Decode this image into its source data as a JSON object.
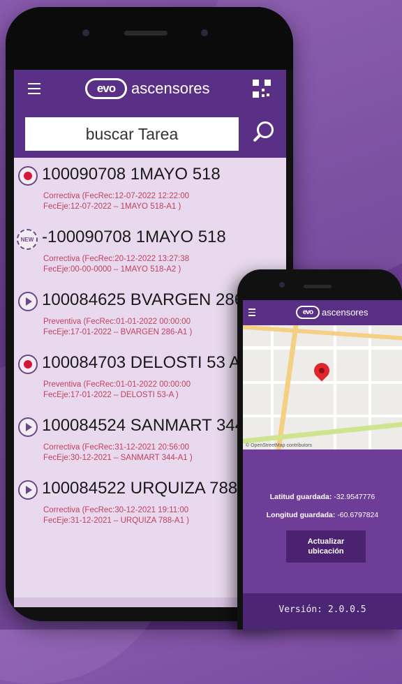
{
  "main_app": {
    "logo_mark": "evo",
    "brand": "ascensores",
    "search_placeholder": "buscar Tarea",
    "tasks": [
      {
        "status": "red-dot",
        "title": "100090708 1MAYO  518",
        "line1": "Correctiva (FecRec:12-07-2022 12:22:00",
        "line2": "FecEje:12-07-2022 –  1MAYO  518-A1 )"
      },
      {
        "status": "new-badge",
        "title": "-100090708 1MAYO  518",
        "line1": "Correctiva (FecRec:20-12-2022 13:27:38",
        "line2": "FecEje:00-00-0000 –  1MAYO  518-A2 )"
      },
      {
        "status": "play",
        "title": "100084625 BVARGEN  286",
        "line1": "Preventiva (FecRec:01-01-2022 00:00:00",
        "line2": "FecEje:17-01-2022 –  BVARGEN  286-A1 )"
      },
      {
        "status": "red-dot",
        "title": "100084703 DELOSTI  53 A",
        "line1": "Preventiva (FecRec:01-01-2022 00:00:00",
        "line2": "FecEje:17-01-2022 –  DELOSTI  53-A )"
      },
      {
        "status": "play",
        "title": "100084524 SANMART  344",
        "line1": "Correctiva (FecRec:31-12-2021 20:56:00",
        "line2": "FecEje:30-12-2021 –  SANMART  344-A1 )"
      },
      {
        "status": "play",
        "title": "100084522 URQUIZA  788",
        "line1": "Correctiva (FecRec:30-12-2021 19:11:00",
        "line2": "FecEje:31-12-2021 –  URQUIZA  788-A1 )"
      }
    ],
    "new_badge_text": "NEW"
  },
  "location_app": {
    "logo_mark": "evo",
    "brand": "ascensores",
    "map_credit": "© OpenStreetMap contributors",
    "latitude_label": "Latitud guardada:",
    "latitude_value": "-32.9547776",
    "longitude_label": "Longitud guardada:",
    "longitude_value": "-60.6797824",
    "update_button_line1": "Actualizar",
    "update_button_line2": "ubicación",
    "version": "Versión: 2.0.0.5"
  },
  "colors": {
    "brand_purple": "#5a2f86",
    "status_red": "#d4183a",
    "subtitle_red": "#c2405e"
  },
  "icons": [
    "menu-icon",
    "qr-code-icon",
    "search-icon",
    "record-icon",
    "new-badge-icon",
    "play-icon",
    "map-pin-icon"
  ]
}
